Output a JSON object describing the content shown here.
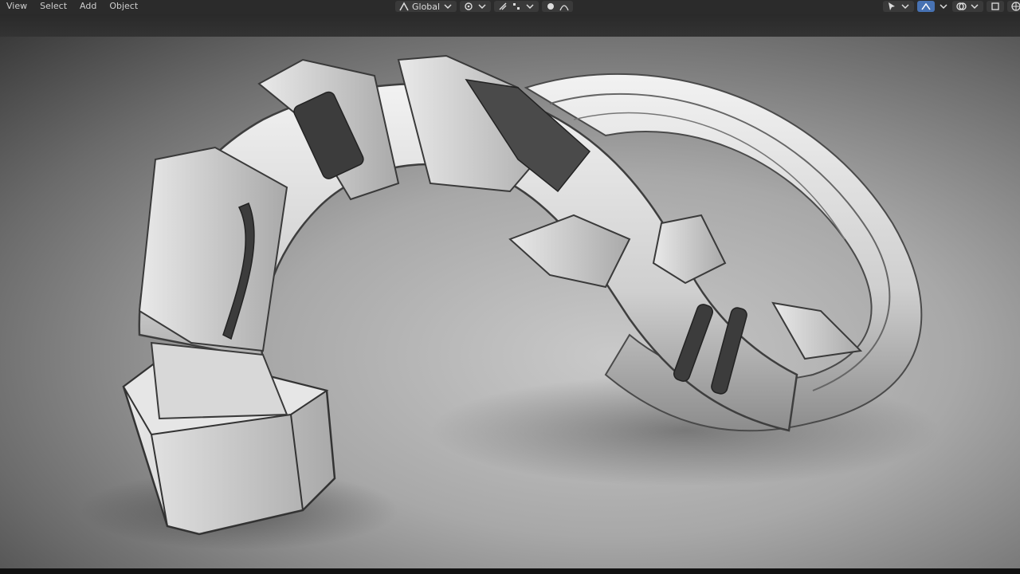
{
  "header": {
    "menu": [
      "View",
      "Select",
      "Add",
      "Object"
    ],
    "orientation": "Global"
  },
  "icons": {
    "transform": "transform-orientation-icon",
    "pivot": "pivot-point-icon",
    "snap": "snap-icon",
    "proportional": "proportional-editing-icon",
    "falloff": "falloff-icon",
    "selectability": "selectability-icon",
    "gizmo": "gizmo-icon",
    "overlay": "overlay-icon",
    "xray": "xray-icon",
    "shading": "viewport-shading-icon"
  },
  "colors": {
    "header": "#2b2b2b",
    "accent": "#4772b3",
    "viewport_bg": "#a8a8a8"
  },
  "scene": {
    "object": "sci-fi curved pipe"
  }
}
